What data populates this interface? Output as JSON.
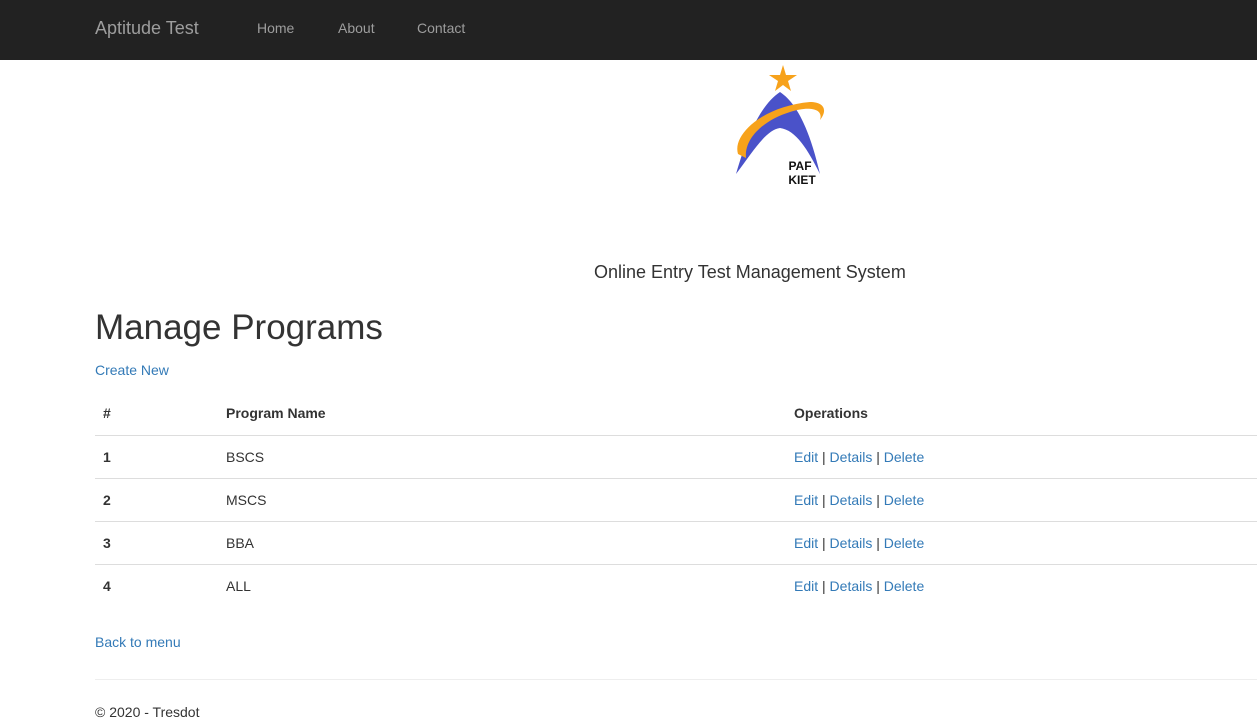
{
  "navbar": {
    "brand": "Aptitude Test",
    "links": [
      "Home",
      "About",
      "Contact"
    ]
  },
  "logo": {
    "icon": "paf-kiet-logo",
    "line1": "PAF",
    "line2": "KIET",
    "colors": {
      "star": "#f7a21b",
      "arch": "#4a52c9",
      "ring": "#f7a21b"
    }
  },
  "subtitle": "Online Entry Test Management System",
  "page": {
    "title": "Manage Programs",
    "create_link": "Create New",
    "back_link": "Back to menu"
  },
  "table": {
    "headers": [
      "#",
      "Program Name",
      "Operations"
    ],
    "rows": [
      {
        "num": "1",
        "name": "BSCS"
      },
      {
        "num": "2",
        "name": "MSCS"
      },
      {
        "num": "3",
        "name": "BBA"
      },
      {
        "num": "4",
        "name": "ALL"
      }
    ],
    "operations": {
      "edit": "Edit",
      "details": "Details",
      "delete": "Delete",
      "separator": "|"
    }
  },
  "footer": {
    "text": "© 2020 - Tresdot"
  },
  "colors": {
    "navbar_bg": "#222222",
    "nav_text": "#9d9d9d",
    "link": "#337ab7"
  }
}
